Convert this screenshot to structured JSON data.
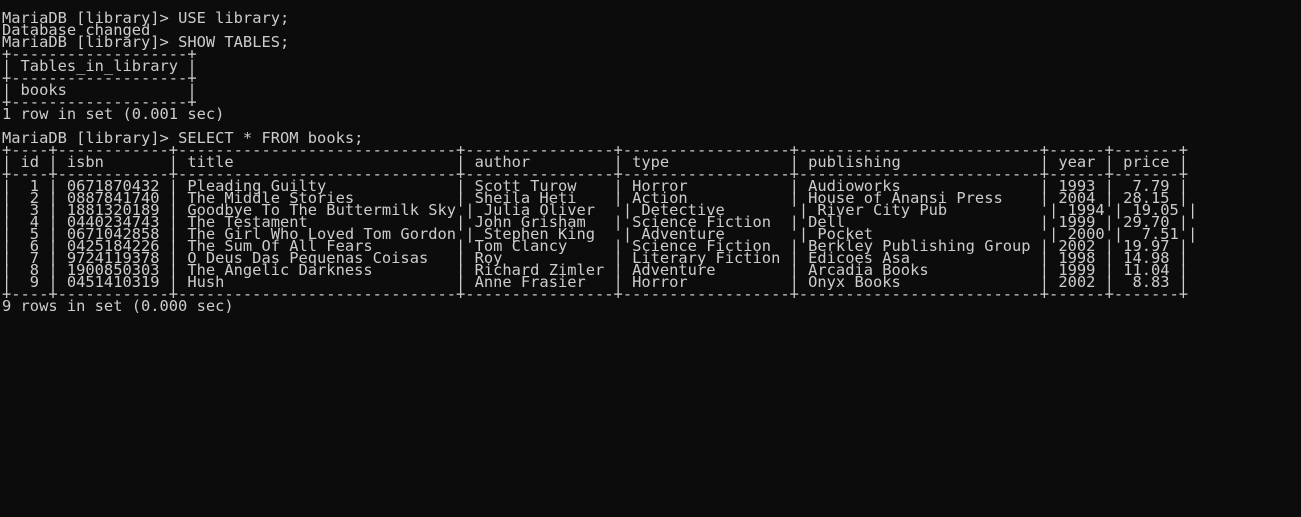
{
  "terminal": {
    "lines": [
      {
        "prompt": "MariaDB [library]> ",
        "command": "USE library;"
      },
      {
        "text": "Database changed"
      },
      {
        "prompt": "MariaDB [library]> ",
        "command": "SHOW TABLES;"
      },
      {
        "text": "+-------------------+"
      },
      {
        "text": "| Tables_in_library |"
      },
      {
        "text": "+-------------------+"
      },
      {
        "text": "| books             |"
      },
      {
        "text": "+-------------------+"
      },
      {
        "text": "1 row in set (0.001 sec)"
      },
      {
        "text": ""
      },
      {
        "prompt": "MariaDB [library]> ",
        "command": "SELECT * FROM books;"
      },
      {
        "text": "+----+------------+------------------------------+----------------+------------------+--------------------------+------+-------+"
      },
      {
        "text": "| id | isbn       | title                        | author         | type             | publishing               | year | price |"
      },
      {
        "text": "+----+------------+------------------------------+----------------+------------------+--------------------------+------+-------+"
      },
      {
        "text": "|  1 | 0671870432 | Pleading Guilty              | Scott Turow    | Horror           | Audioworks               | 1993 |  7.79 |"
      },
      {
        "text": "|  2 | 0887841740 | The Middle Stories           | Sheila Heti    | Action           | House of Anansi Press    | 2004 | 28.15 |"
      },
      {
        "text": "|  3 | 1881320189 | Goodbye To The Buttermilk Sky | Julia Oliver   | Detective        | River City Pub           | 1994 | 19.05 |"
      },
      {
        "text": "|  4 | 0440234743 | The Testament                | John Grisham   | Science Fiction  | Dell                     | 1999 | 29.70 |"
      },
      {
        "text": "|  5 | 0671042858 | The Girl Who Loved Tom Gordon | Stephen King   | Adventure        | Pocket                   | 2000 |  7.51 |"
      },
      {
        "text": "|  6 | 0425184226 | The Sum Of All Fears         | Tom Clancy     | Science Fiction  | Berkley Publishing Group | 2002 | 19.97 |"
      },
      {
        "text": "|  7 | 9724119378 | O Deus Das Pequenas Coisas   | Roy            | Literary Fiction | Edicoes Asa              | 1998 | 14.98 |"
      },
      {
        "text": "|  8 | 1900850303 | The Angelic Darkness         | Richard Zimler | Adventure        | Arcadia Books            | 1999 | 11.04 |"
      },
      {
        "text": "|  9 | 0451410319 | Hush                         | Anne Frasier   | Horror           | Onyx Books               | 2002 |  8.83 |"
      },
      {
        "text": "+----+------------+------------------------------+----------------+------------------+--------------------------+------+-------+"
      },
      {
        "text": "9 rows in set (0.000 sec)"
      }
    ]
  }
}
